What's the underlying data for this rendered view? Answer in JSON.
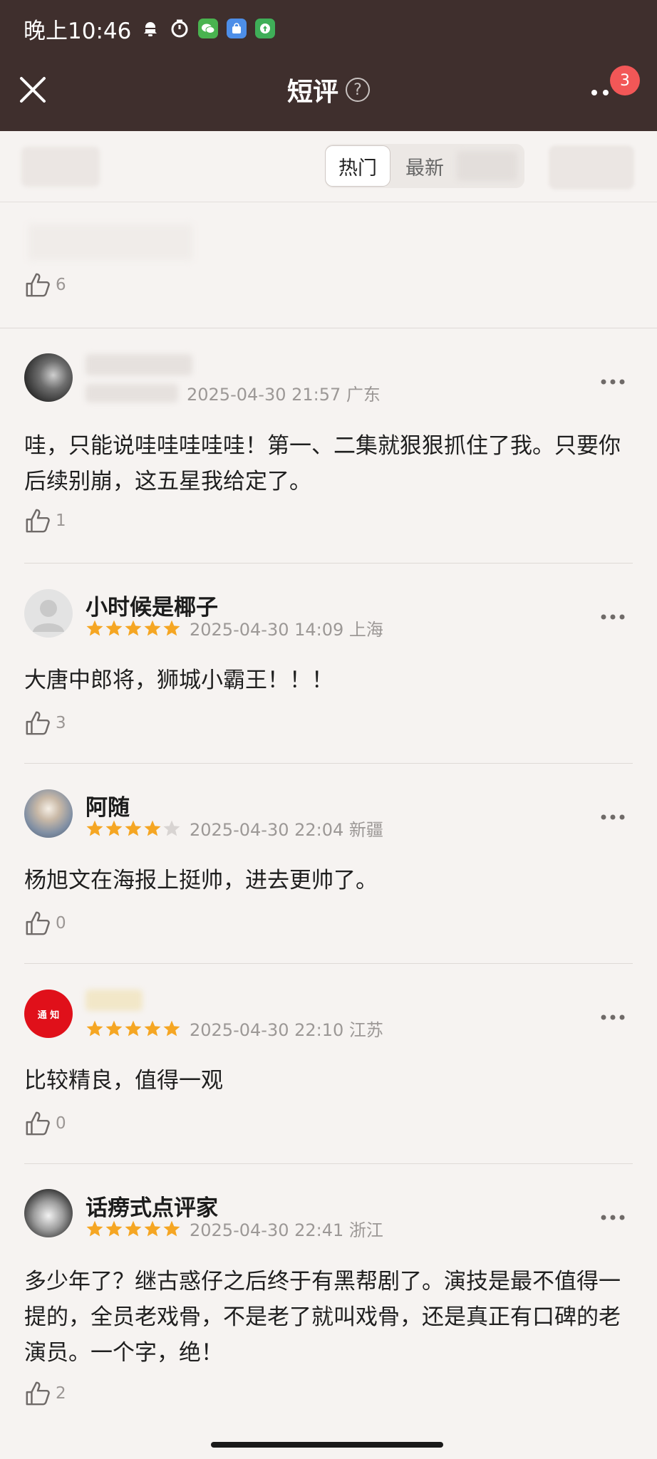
{
  "status_bar": {
    "time": "晚上10:46"
  },
  "header": {
    "title": "短评",
    "help_label": "?",
    "notification_count": "3"
  },
  "tabs": {
    "hot": "热门",
    "new": "最新"
  },
  "first_item": {
    "likes": "6"
  },
  "reviews": [
    {
      "user": "",
      "time": "2025-04-30 21:57 广东",
      "content": "哇，只能说哇哇哇哇哇！第一、二集就狠狠抓住了我。只要你后续别崩，这五星我给定了。",
      "likes": "1",
      "rating": 0
    },
    {
      "user": "小时候是椰子",
      "time": "2025-04-30 14:09 上海",
      "content": "大唐中郎将，狮城小霸王！！！",
      "likes": "3",
      "rating": 5
    },
    {
      "user": "阿随",
      "time": "2025-04-30 22:04 新疆",
      "content": "杨旭文在海报上挺帅，进去更帅了。",
      "likes": "0",
      "rating": 4
    },
    {
      "user": "",
      "avatar_text": "通 知",
      "time": "2025-04-30 22:10 江苏",
      "content": "比较精良，值得一观",
      "likes": "0",
      "rating": 5
    },
    {
      "user": "话痨式点评家",
      "time": "2025-04-30 22:41 浙江",
      "content": "多少年了？继古惑仔之后终于有黑帮剧了。演技是最不值得一提的，全员老戏骨，不是老了就叫戏骨，还是真正有口碑的老演员。一个字，绝！",
      "likes": "2",
      "rating": 5
    }
  ],
  "colors": {
    "star": "#f5a623",
    "star_empty": "#d8d4d2",
    "header_bg": "#3f2f2d",
    "badge": "#f25757"
  }
}
